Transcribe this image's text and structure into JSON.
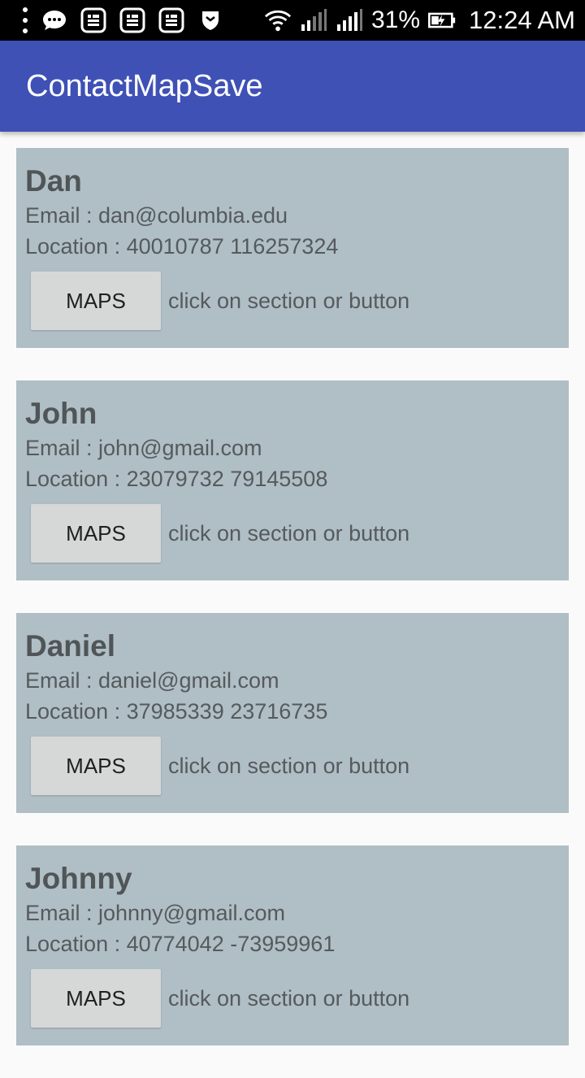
{
  "status_bar": {
    "battery_percent": "31%",
    "time": "12:24 AM"
  },
  "app": {
    "title": "ContactMapSave"
  },
  "contacts": [
    {
      "name": "Dan",
      "email_line": "Email : dan@columbia.edu",
      "location_line": "Location : 40010787 116257324",
      "button_label": "MAPS",
      "hint": "click on section or button"
    },
    {
      "name": "John",
      "email_line": "Email : john@gmail.com",
      "location_line": "Location : 23079732 79145508",
      "button_label": "MAPS",
      "hint": "click on section or button"
    },
    {
      "name": "Daniel",
      "email_line": "Email : daniel@gmail.com",
      "location_line": "Location : 37985339 23716735",
      "button_label": "MAPS",
      "hint": "click on section or button"
    },
    {
      "name": "Johnny",
      "email_line": "Email : johnny@gmail.com",
      "location_line": "Location : 40774042 -73959961",
      "button_label": "MAPS",
      "hint": "click on section or button"
    }
  ]
}
